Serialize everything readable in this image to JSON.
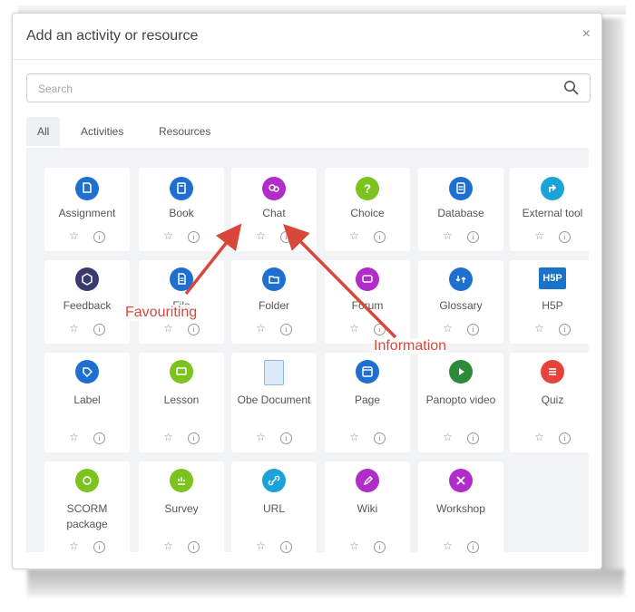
{
  "modal": {
    "title": "Add an activity or resource",
    "close_label": "×"
  },
  "search": {
    "placeholder": "Search"
  },
  "tabs": [
    {
      "label": "All",
      "active": true
    },
    {
      "label": "Activities",
      "active": false
    },
    {
      "label": "Resources",
      "active": false
    }
  ],
  "items": [
    {
      "label": "Assignment",
      "icon": "assignment-icon",
      "color": "#1f6fd1"
    },
    {
      "label": "Book",
      "icon": "book-icon",
      "color": "#1f6fd1"
    },
    {
      "label": "Chat",
      "icon": "chat-icon",
      "color": "#b12cc8"
    },
    {
      "label": "Choice",
      "icon": "choice-icon",
      "color": "#7cc31f"
    },
    {
      "label": "Database",
      "icon": "database-icon",
      "color": "#1f6fd1"
    },
    {
      "label": "External tool",
      "icon": "external-tool-icon",
      "color": "#1aa3d9"
    },
    {
      "label": "Feedback",
      "icon": "feedback-icon",
      "color": "#3a3a6e"
    },
    {
      "label": "File",
      "icon": "file-icon",
      "color": "#1f6fd1"
    },
    {
      "label": "Folder",
      "icon": "folder-icon",
      "color": "#1f6fd1"
    },
    {
      "label": "Forum",
      "icon": "forum-icon",
      "color": "#b12cc8"
    },
    {
      "label": "Glossary",
      "icon": "glossary-icon",
      "color": "#1f6fd1"
    },
    {
      "label": "H5P",
      "icon": "h5p-icon",
      "color": "#1a73c9"
    },
    {
      "label": "Label",
      "icon": "label-icon",
      "color": "#1f6fd1"
    },
    {
      "label": "Lesson",
      "icon": "lesson-icon",
      "color": "#7cc31f"
    },
    {
      "label": "Obe Document",
      "icon": "document-icon",
      "color": "#8fb7e6"
    },
    {
      "label": "Page",
      "icon": "page-icon",
      "color": "#1f6fd1"
    },
    {
      "label": "Panopto video",
      "icon": "video-icon",
      "color": "#2c8a3a"
    },
    {
      "label": "Quiz",
      "icon": "quiz-icon",
      "color": "#e8423c"
    },
    {
      "label": "SCORM package",
      "icon": "scorm-icon",
      "color": "#7cc31f"
    },
    {
      "label": "Survey",
      "icon": "survey-icon",
      "color": "#7cc31f"
    },
    {
      "label": "URL",
      "icon": "url-icon",
      "color": "#1aa3d9"
    },
    {
      "label": "Wiki",
      "icon": "wiki-icon",
      "color": "#b12cc8"
    },
    {
      "label": "Workshop",
      "icon": "workshop-icon",
      "color": "#b12cc8"
    }
  ],
  "annotations": {
    "favouriting": "Favouriting",
    "information": "Information",
    "color": "#d9473b"
  }
}
